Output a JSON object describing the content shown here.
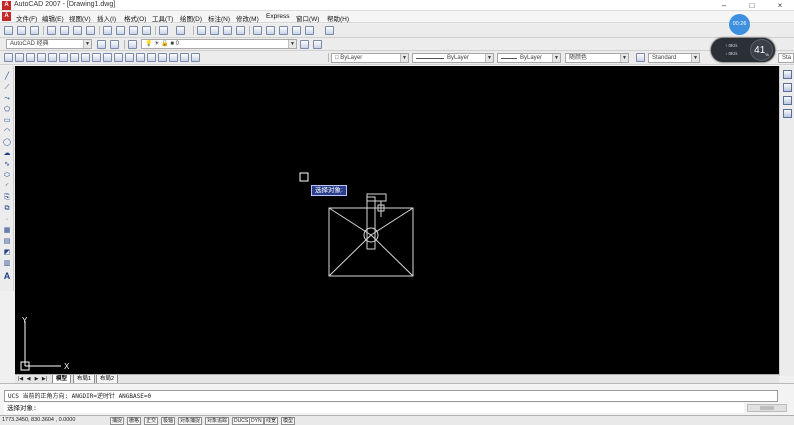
{
  "window": {
    "title": "AutoCAD 2007 - [Drawing1.dwg]",
    "minimize": "–",
    "maximize": "□",
    "close": "×"
  },
  "menu": [
    "文件(F)",
    "编辑(E)",
    "视图(V)",
    "插入(I)",
    "格式(O)",
    "工具(T)",
    "绘图(D)",
    "标注(N)",
    "修改(M)",
    "Express",
    "窗口(W)",
    "帮助(H)"
  ],
  "toolbar": {
    "workspace": "AutoCAD 经典",
    "layer": "0",
    "color": "ByLayer",
    "linetype": "ByLayer",
    "lineweight": "ByLayer",
    "plotstyle": "随颜色",
    "textstyle": "Standard",
    "dimstyle": "Sta"
  },
  "overlay": {
    "timer": "00:26",
    "upload_rate": "0K/s",
    "download_rate": "0K/s",
    "percent": "41",
    "percent_unit": "%"
  },
  "canvas": {
    "tooltip": "选择对象:",
    "ucs_x": "X",
    "ucs_y": "Y"
  },
  "tabs": [
    "模型",
    "布局1",
    "布局2"
  ],
  "command": {
    "history": "UCS 当前的正角方向:  ANGDIR=逆时针  ANGBASE=0",
    "prompt": "选择对象:"
  },
  "status": {
    "coords": "1773.3450, 830.3604 , 0.0000",
    "toggles": [
      "捕捉",
      "栅格",
      "正交",
      "极轴",
      "对象捕捉",
      "对象追踪",
      "DUCS",
      "DYN",
      "线宽",
      "模型"
    ]
  }
}
